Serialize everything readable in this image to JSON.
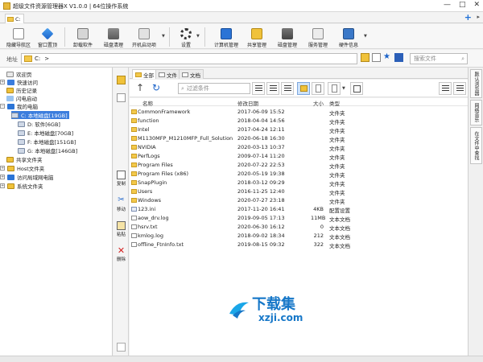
{
  "window": {
    "title": "超级文件资源管理器X V1.0.0  |  64位操作系统",
    "controls": [
      "—",
      "□",
      "✕"
    ]
  },
  "tabstrip": {
    "tabs": [
      {
        "label": "C:"
      }
    ],
    "new_tab": "+"
  },
  "toolbar": {
    "buttons": [
      {
        "label": "隐藏导航区",
        "icon": "hide-nav-icon"
      },
      {
        "label": "窗口置顶",
        "icon": "pin-icon"
      },
      {
        "label": "卸载软件",
        "icon": "uninstall-icon"
      },
      {
        "label": "磁盘清理",
        "icon": "disk-clean-icon"
      },
      {
        "label": "开机启动项",
        "icon": "startup-icon"
      },
      {
        "label": "设置",
        "icon": "gear-icon"
      },
      {
        "label": "计算机管理",
        "icon": "computer-manage-icon"
      },
      {
        "label": "共享管理",
        "icon": "share-manage-icon"
      },
      {
        "label": "磁盘管理",
        "icon": "disk-manage-icon"
      },
      {
        "label": "服务管理",
        "icon": "service-manage-icon"
      },
      {
        "label": "硬件信息",
        "icon": "hardware-info-icon"
      }
    ]
  },
  "address": {
    "label": "地址",
    "path": "C:",
    "chevron": ">",
    "search_placeholder": "搜索文件"
  },
  "tree": {
    "items": [
      {
        "label": "欢迎页"
      },
      {
        "label": "快速访问"
      },
      {
        "label": "历史记录"
      },
      {
        "label": "闪电启动"
      },
      {
        "label": "我的电脑"
      },
      {
        "label": "C: 本地磁盘[19GB]"
      },
      {
        "label": "D: 软件[6GB]"
      },
      {
        "label": "E: 本地磁盘[70GB]"
      },
      {
        "label": "F: 本地磁盘[151GB]"
      },
      {
        "label": "G: 本地磁盘[146GB]"
      },
      {
        "label": "共享文件夹"
      },
      {
        "label": "Host文件夹"
      },
      {
        "label": "访问局域网电脑"
      },
      {
        "label": "系统文件夹"
      }
    ]
  },
  "actions": {
    "copy": "复制",
    "move": "移动",
    "paste": "粘贴",
    "delete": "删除"
  },
  "content_tabs": [
    {
      "label": "全部"
    },
    {
      "label": "文件"
    },
    {
      "label": "文档"
    }
  ],
  "filter": {
    "placeholder": "过滤条件"
  },
  "columns": {
    "name": "名称",
    "date": "修改日期",
    "size": "大小",
    "type": "类型"
  },
  "files": [
    {
      "name": "CommonFramework",
      "date": "2017-06-09 15:52",
      "size": "",
      "type": "文件夹",
      "kind": "folder"
    },
    {
      "name": "function",
      "date": "2018-04-04 14:56",
      "size": "",
      "type": "文件夹",
      "kind": "folder"
    },
    {
      "name": "Intel",
      "date": "2017-04-24 12:11",
      "size": "",
      "type": "文件夹",
      "kind": "folder"
    },
    {
      "name": "M1130MFP_M1210MFP_Full_Solution",
      "date": "2020-06-18 16:30",
      "size": "",
      "type": "文件夹",
      "kind": "folder"
    },
    {
      "name": "NVIDIA",
      "date": "2020-03-13 10:37",
      "size": "",
      "type": "文件夹",
      "kind": "folder"
    },
    {
      "name": "PerfLogs",
      "date": "2009-07-14 11:20",
      "size": "",
      "type": "文件夹",
      "kind": "folder"
    },
    {
      "name": "Program Files",
      "date": "2020-07-22 22:53",
      "size": "",
      "type": "文件夹",
      "kind": "folder"
    },
    {
      "name": "Program Files (x86)",
      "date": "2020-05-19 19:38",
      "size": "",
      "type": "文件夹",
      "kind": "folder"
    },
    {
      "name": "SnapPlugin",
      "date": "2018-03-12 09:29",
      "size": "",
      "type": "文件夹",
      "kind": "folder"
    },
    {
      "name": "Users",
      "date": "2016-11-25 12:40",
      "size": "",
      "type": "文件夹",
      "kind": "folder"
    },
    {
      "name": "Windows",
      "date": "2020-07-27 23:18",
      "size": "",
      "type": "文件夹",
      "kind": "folder"
    },
    {
      "name": "123.ini",
      "date": "2017-11-20 16:41",
      "size": "4KB",
      "type": "配置设置",
      "kind": "ini"
    },
    {
      "name": "aow_drv.log",
      "date": "2019-09-05 17:13",
      "size": "11MB",
      "type": "文本文档",
      "kind": "file"
    },
    {
      "name": "hsrv.txt",
      "date": "2020-06-30 16:12",
      "size": "0",
      "type": "文本文档",
      "kind": "file"
    },
    {
      "name": "kmlog.log",
      "date": "2018-09-02 18:34",
      "size": "212",
      "type": "文本文档",
      "kind": "file"
    },
    {
      "name": "offline_FtnInfo.txt",
      "date": "2019-08-15 09:32",
      "size": "322",
      "type": "文本文档",
      "kind": "file"
    }
  ],
  "side_tabs": [
    {
      "label": "默认浏览器"
    },
    {
      "label": "网络音乐"
    },
    {
      "label": "在文件中查找"
    }
  ],
  "watermark": {
    "big": "下载集",
    "small": "xzji.com"
  }
}
